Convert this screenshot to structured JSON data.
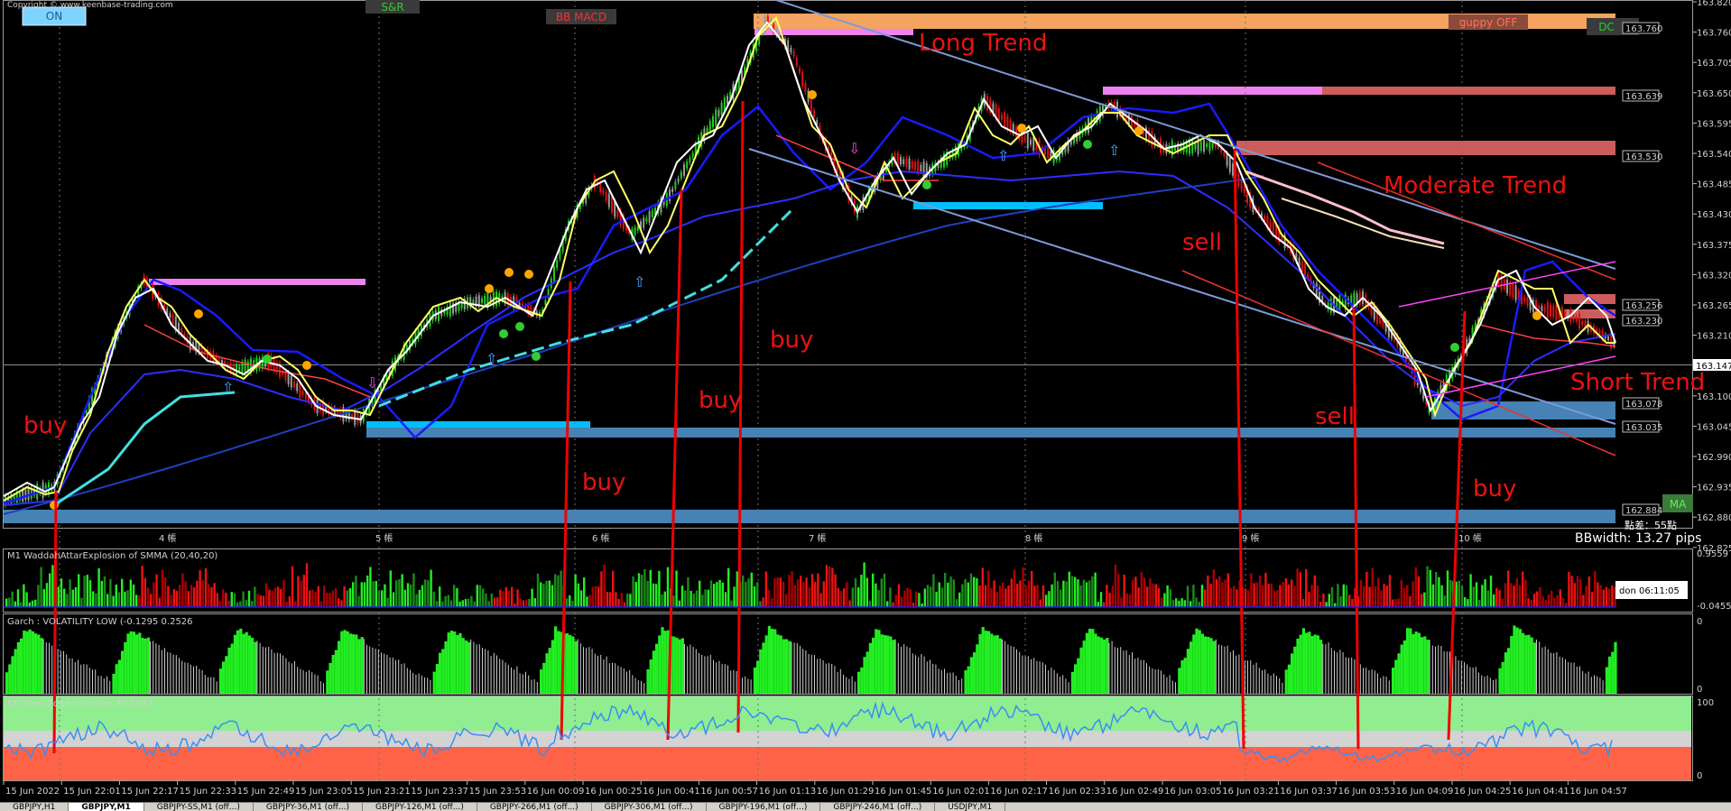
{
  "copyright": "Copyright © www.keenbase-trading.com",
  "buttons": {
    "on": "ON",
    "sr": "S&R",
    "bbmacd": "BB MACD",
    "guppy": "guppy OFF",
    "dc": "DC",
    "ma": "MA"
  },
  "price_axis": {
    "ticks": [
      "163.820",
      "163.760",
      "163.705",
      "163.650",
      "163.595",
      "163.540",
      "163.485",
      "163.430",
      "163.375",
      "163.320",
      "163.265",
      "163.210",
      "163.155",
      "163.100",
      "163.045",
      "162.990",
      "162.935",
      "162.880",
      "162.825"
    ],
    "level_labels": [
      "163.760",
      "163.639",
      "163.530",
      "163.256",
      "163.230",
      "163.078",
      "163.035",
      "162.884"
    ],
    "current_price": "163.147"
  },
  "day_labels": [
    "4 帳",
    "5 帳",
    "6 帳",
    "7 帳",
    "8 帳",
    "9 帳",
    "10 帳"
  ],
  "annotations": {
    "long_trend": "Long Trend",
    "moderate_trend": "Moderate Trend",
    "short_trend": "Short Trend",
    "buy": "buy",
    "sell": "sell"
  },
  "bb_info": {
    "spread": "點差：55點",
    "bbwidth": "BBwidth: 13.27 pips"
  },
  "indicators": {
    "waddah": {
      "title": "M1 WaddahAttarExplosion of SMMA (20,40,20)",
      "top": "0.9559",
      "bottom": "-0.0455",
      "timer": "don 06:11:05"
    },
    "garch": {
      "title": "Garch : VOLATILITY LOW (-0.1295 0.2526",
      "top": "0",
      "bottom": "0"
    },
    "chop": {
      "title": "KT Chop Zone indicator 30.2847",
      "top": "100",
      "bottom": "0"
    }
  },
  "time_axis": [
    "15 Jun 2022",
    "15 Jun 22:01",
    "15 Jun 22:17",
    "15 Jun 22:33",
    "15 Jun 22:49",
    "15 Jun 23:05",
    "15 Jun 23:21",
    "15 Jun 23:37",
    "15 Jun 23:53",
    "16 Jun 00:09",
    "16 Jun 00:25",
    "16 Jun 00:41",
    "16 Jun 00:57",
    "16 Jun 01:13",
    "16 Jun 01:29",
    "16 Jun 01:45",
    "16 Jun 02:01",
    "16 Jun 02:17",
    "16 Jun 02:33",
    "16 Jun 02:49",
    "16 Jun 03:05",
    "16 Jun 03:21",
    "16 Jun 03:37",
    "16 Jun 03:53",
    "16 Jun 04:09",
    "16 Jun 04:25",
    "16 Jun 04:41",
    "16 Jun 04:57"
  ],
  "tabs": [
    "GBPJPY,H1",
    "GBPJPY,M1",
    "GBPJPY-SS,M1 (off...)",
    "GBPJPY-36,M1 (off...)",
    "GBPJPY-126,M1 (off...)",
    "GBPJPY-266,M1 (off...)",
    "GBPJPY-306,M1 (off...)",
    "GBPJPY-196,M1 (off...)",
    "GBPJPY-246,M1 (off...)",
    "USDJPY,M1"
  ],
  "colors": {
    "bull": "#22dd22",
    "bear": "#ee1111",
    "accent_red": "#ee1111",
    "pink": "#ee82ee",
    "orange": "#f4a460",
    "cyan": "#00bfff",
    "steel": "#4682b4",
    "salmon": "#cd5c5c"
  }
}
